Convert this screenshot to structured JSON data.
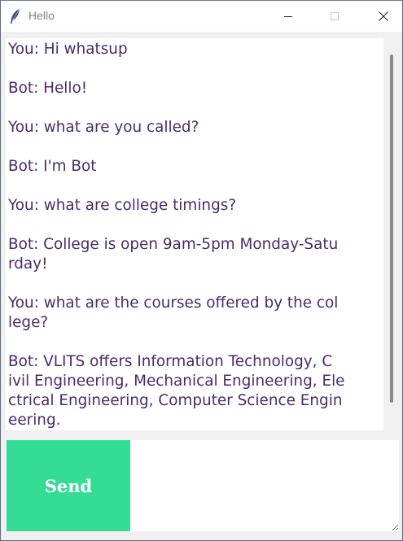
{
  "window": {
    "title": "Hello",
    "icon": "feather-icon",
    "controls": [
      "minimize-icon",
      "maximize-icon",
      "close-icon"
    ]
  },
  "chat": {
    "lines": [
      "You: Hi whatsup",
      "",
      "Bot: Hello!",
      "",
      "You: what are you called?",
      "",
      "Bot: I'm Bot",
      "",
      "You: what are college timings?",
      "",
      "Bot: College is open 9am-5pm Monday-Satu",
      "rday!",
      "",
      "You: what are the courses offered by the col",
      "lege?",
      "",
      "Bot: VLITS offers Information Technology, C",
      "ivil Engineering, Mechanical Engineering, Ele",
      "ctrical Engineering, Computer Science Engin",
      "eering."
    ]
  },
  "send": {
    "label": "Send",
    "color": "#35dc96"
  },
  "entry": {
    "value": ""
  }
}
